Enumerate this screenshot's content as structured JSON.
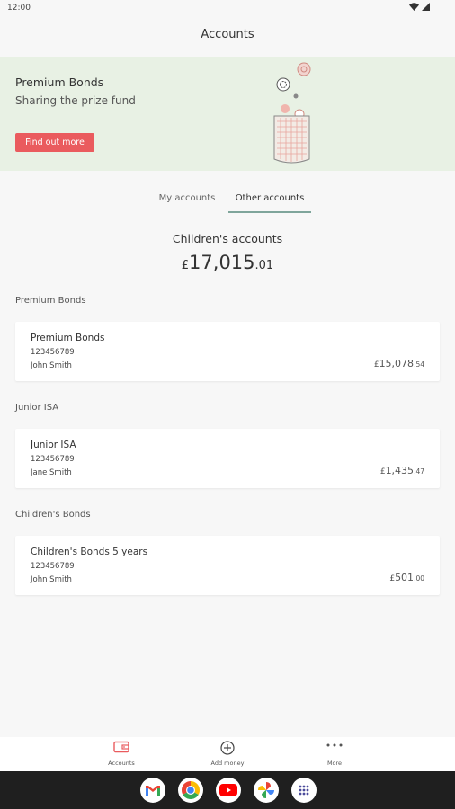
{
  "status_bar": {
    "time": "12:00"
  },
  "header": {
    "title": "Accounts"
  },
  "promo": {
    "title": "Premium Bonds",
    "subtitle": "Sharing the prize fund",
    "button_label": "Find out more"
  },
  "tabs": [
    {
      "label": "My accounts",
      "selected": false
    },
    {
      "label": "Other accounts",
      "selected": true
    }
  ],
  "summary": {
    "title": "Children's accounts",
    "currency": "£",
    "amount_main": "17,015",
    "amount_pence": ".01"
  },
  "sections": [
    {
      "label": "Premium Bonds",
      "account": {
        "name": "Premium Bonds",
        "number": "123456789",
        "holder": "John Smith",
        "currency": "£",
        "balance_main": "15,078",
        "balance_pence": ".54"
      }
    },
    {
      "label": "Junior ISA",
      "account": {
        "name": "Junior ISA",
        "number": "123456789",
        "holder": "Jane Smith",
        "currency": "£",
        "balance_main": "1,435",
        "balance_pence": ".47"
      }
    },
    {
      "label": "Children's Bonds",
      "account": {
        "name": "Children's Bonds 5 years",
        "number": "123456789",
        "holder": "John Smith",
        "currency": "£",
        "balance_main": "501",
        "balance_pence": ".00"
      }
    }
  ],
  "bottom_nav": [
    {
      "label": "Accounts",
      "icon": "accounts-icon",
      "active": true
    },
    {
      "label": "Add money",
      "icon": "add-circle-icon",
      "active": false
    },
    {
      "label": "More",
      "icon": "more-dots-icon",
      "active": false
    }
  ],
  "dock": [
    {
      "name": "Gmail",
      "icon": "gmail-icon"
    },
    {
      "name": "Chrome",
      "icon": "chrome-icon"
    },
    {
      "name": "YouTube",
      "icon": "youtube-icon"
    },
    {
      "name": "Photos",
      "icon": "photos-icon"
    },
    {
      "name": "App drawer",
      "icon": "app-drawer-icon"
    }
  ],
  "colors": {
    "accent_red": "#ea5b5e",
    "promo_bg": "#e8f1e4",
    "tab_underline": "#7fa59b",
    "background": "#f7f7f7"
  }
}
